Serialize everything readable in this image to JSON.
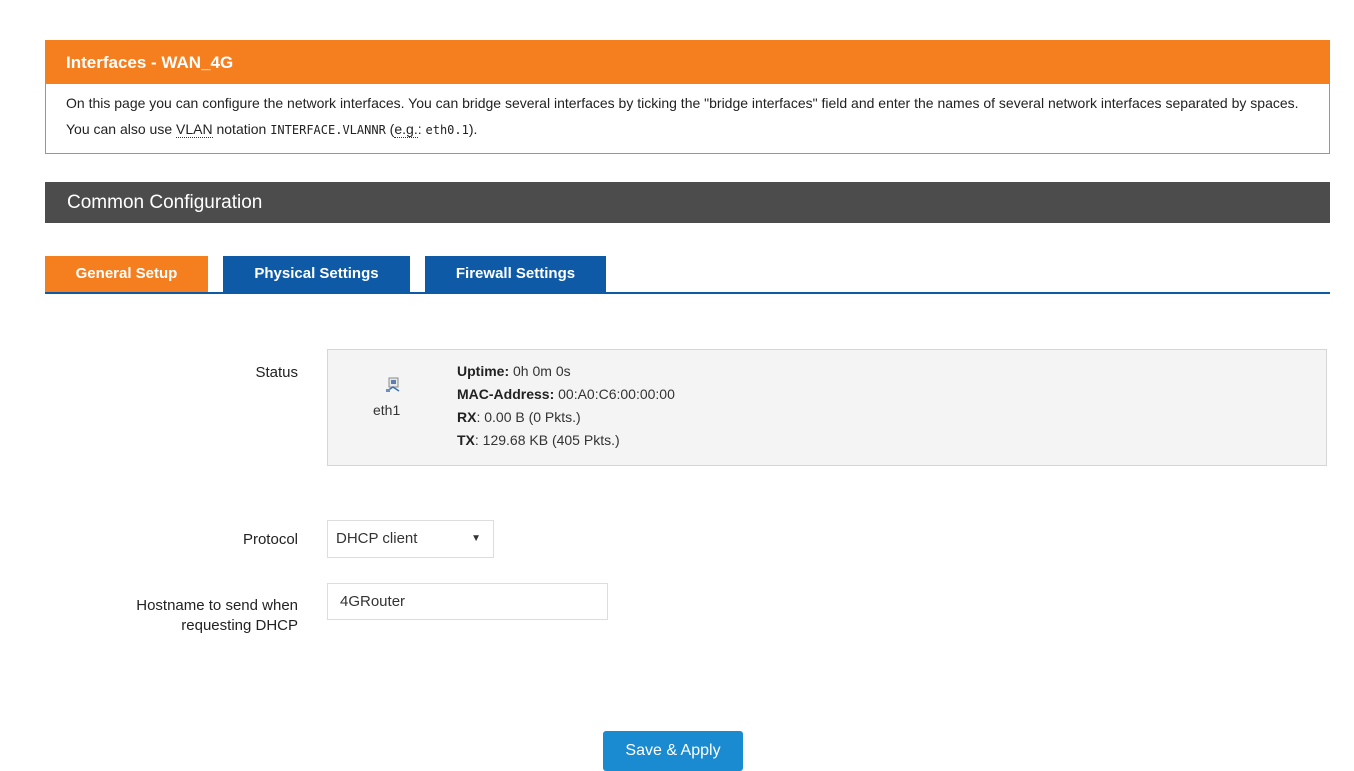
{
  "header": {
    "title": "Interfaces - WAN_4G",
    "desc_part1": "On this page you can configure the network interfaces. You can bridge several interfaces by ticking the \"bridge interfaces\" field and enter the names of several network interfaces separated by spaces. You can also use ",
    "vlan": "VLAN",
    "desc_part2": " notation ",
    "vlan_code": "INTERFACE.VLANNR",
    "desc_part3": " (",
    "eg": "e.g.",
    "desc_part4": ": ",
    "eg_code": "eth0.1",
    "desc_part5": ")."
  },
  "section": {
    "title": "Common Configuration"
  },
  "tabs": [
    {
      "label": "General Setup"
    },
    {
      "label": "Physical Settings"
    },
    {
      "label": "Firewall Settings"
    }
  ],
  "status": {
    "label": "Status",
    "iface_name": "eth1",
    "uptime_label": "Uptime:",
    "uptime_value": " 0h 0m 0s",
    "mac_label": "MAC-Address:",
    "mac_value": " 00:A0:C6:00:00:00",
    "rx_label": "RX",
    "rx_value": ": 0.00 B (0 Pkts.)",
    "tx_label": "TX",
    "tx_value": ": 129.68 KB (405 Pkts.)"
  },
  "protocol": {
    "label": "Protocol",
    "value": "DHCP client"
  },
  "hostname": {
    "label_line1": "Hostname to send when",
    "label_line2": "requesting DHCP",
    "value": "4GRouter"
  },
  "actions": {
    "save_label": "Save & Apply"
  },
  "colors": {
    "accent": "#f57e1f",
    "tab_blue": "#0e5aa7",
    "button_blue": "#1a8ad1",
    "section_bg": "#4c4c4c"
  }
}
